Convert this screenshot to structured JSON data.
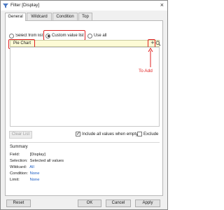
{
  "window": {
    "title": "Filter [Display]"
  },
  "tabs": [
    {
      "label": "General",
      "active": true
    },
    {
      "label": "Wildcard",
      "active": false
    },
    {
      "label": "Condition",
      "active": false
    },
    {
      "label": "Top",
      "active": false
    }
  ],
  "mode": {
    "select_from_list": "Select from list",
    "custom_value_list": "Custom value list",
    "use_all": "Use all",
    "selected": "custom_value_list"
  },
  "entry": {
    "value": "Pie Chart"
  },
  "annotation": {
    "text": "To Add",
    "color": "#e02020"
  },
  "clear_list": "Clear List",
  "include_all": {
    "label": "Include all values when empty",
    "checked": true
  },
  "exclude": {
    "label": "Exclude",
    "checked": false
  },
  "summary": {
    "heading": "Summary",
    "rows": [
      {
        "label": "Field:",
        "value": "[Display]"
      },
      {
        "label": "Selection:",
        "value": "Selected all values"
      },
      {
        "label": "Wildcard:",
        "value": "All"
      },
      {
        "label": "Condition:",
        "value": "None"
      },
      {
        "label": "Limit:",
        "value": "None"
      }
    ]
  },
  "buttons": {
    "reset": "Reset",
    "ok": "OK",
    "cancel": "Cancel",
    "apply": "Apply"
  }
}
